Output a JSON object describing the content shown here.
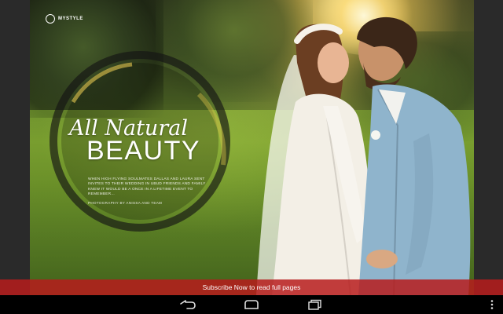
{
  "magazine": {
    "brand": "MYSTYLE",
    "headline_script": "All Natural",
    "headline_main": "BEAUTY",
    "intro": "WHEN HIGH FLYING SOULMATES DALLAS AND LAURA SENT INVITES TO THEIR WEDDING IN UBUD FRIENDS AND FAMILY KNEW IT WOULD BE A ONCE IN A LIFETIME EVENT TO REMEMBER...",
    "photo_credit": "PHOTOGRAPHY BY ANISSA AND TEAM"
  },
  "subscribe": {
    "label": "Subscribe Now to read full pages",
    "color": "#b71c1c"
  },
  "nav": {
    "buttons": [
      "back-icon",
      "home-icon",
      "recent-apps-icon",
      "menu-icon"
    ]
  },
  "colors": {
    "accent_red": "#b71c1c",
    "text_white": "#ffffff",
    "nav_bg": "#000000",
    "frame_bg": "#2a2a2a"
  }
}
